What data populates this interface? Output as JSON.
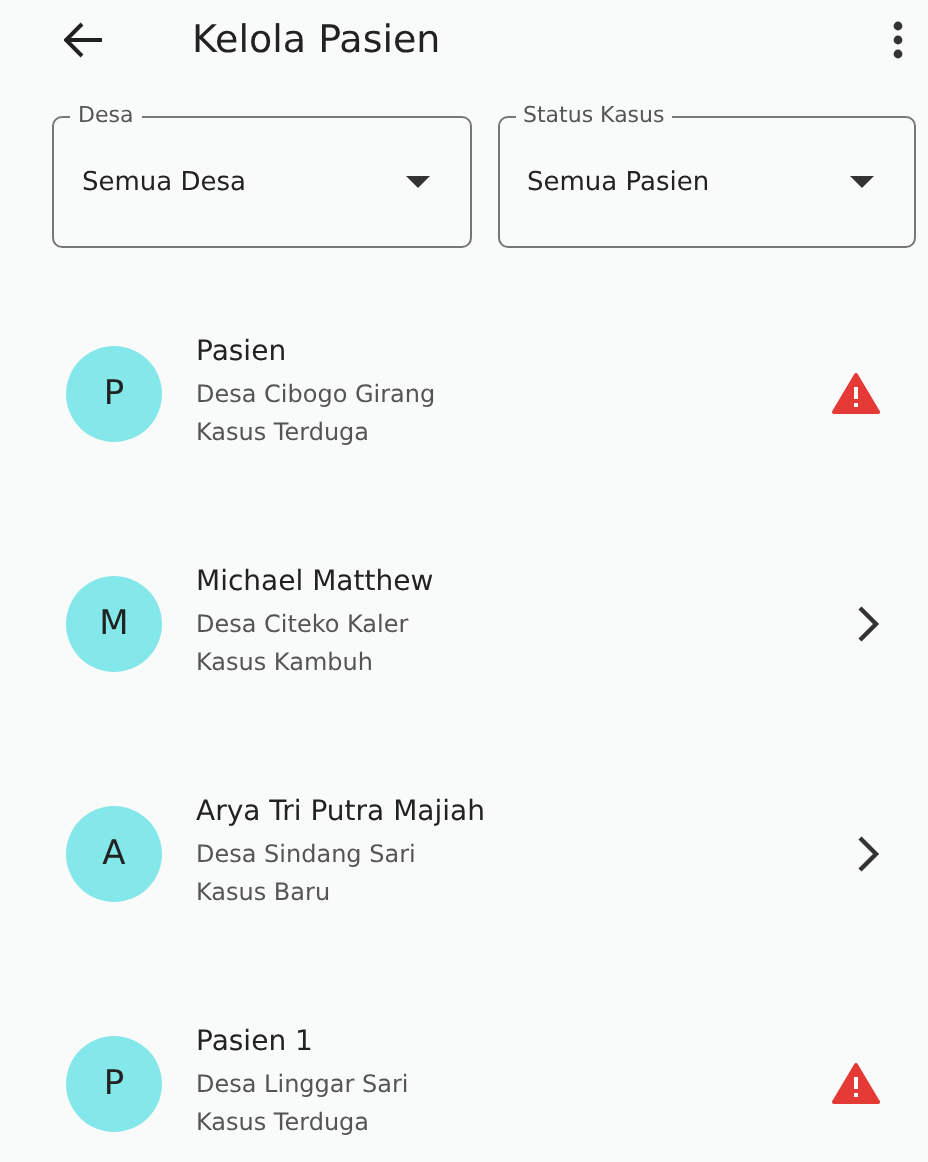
{
  "app_bar": {
    "title": "Kelola Pasien"
  },
  "filters": [
    {
      "label": "Desa",
      "value": "Semua Desa"
    },
    {
      "label": "Status Kasus",
      "value": "Semua Pasien"
    }
  ],
  "patients": [
    {
      "initial": "P",
      "name": "Pasien",
      "village": "Desa Cibogo Girang",
      "case": "Kasus Terduga",
      "kind": "warning"
    },
    {
      "initial": "M",
      "name": "Michael Matthew",
      "village": "Desa Citeko Kaler",
      "case": "Kasus Kambuh",
      "kind": "chevron"
    },
    {
      "initial": "A",
      "name": "Arya Tri Putra Majiah",
      "village": "Desa Sindang Sari",
      "case": "Kasus Baru",
      "kind": "chevron"
    },
    {
      "initial": "P",
      "name": "Pasien 1",
      "village": "Desa Linggar Sari",
      "case": "Kasus Terduga",
      "kind": "warning"
    }
  ]
}
